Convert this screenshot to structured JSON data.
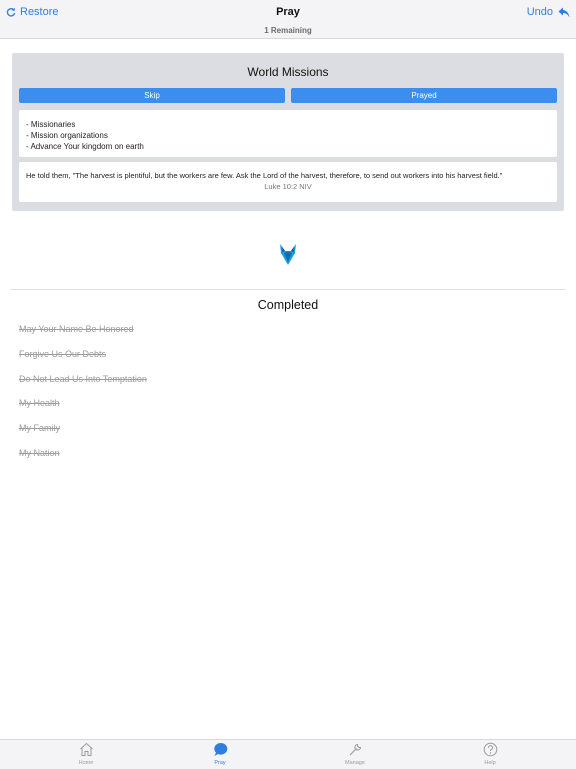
{
  "nav": {
    "restore_label": "Restore",
    "title": "Pray",
    "subtitle": "1 Remaining",
    "undo_label": "Undo"
  },
  "card": {
    "title": "World Missions",
    "skip_label": "Skip",
    "prayed_label": "Prayed",
    "points": [
      "- Missionaries",
      "- Mission organizations",
      "- Advance Your kingdom on earth"
    ],
    "verse_text": "He told them, \"The harvest is plentiful, but the workers are few. Ask the Lord of the harvest, therefore, to send out workers into his harvest field.\"",
    "verse_ref": "Luke 10:2 NIV"
  },
  "completed": {
    "title": "Completed",
    "items": [
      "May Your Name Be Honored",
      "Forgive Us Our Debts",
      "Do Not Lead Us Into Temptation",
      "My Health",
      "My Family",
      "My Nation"
    ]
  },
  "tabs": [
    {
      "label": "Home",
      "icon": "home-icon"
    },
    {
      "label": "Pray",
      "icon": "chat-bubble-icon"
    },
    {
      "label": "Manage",
      "icon": "wrench-icon"
    },
    {
      "label": "Help",
      "icon": "question-icon"
    }
  ],
  "colors": {
    "accent": "#2e7de1",
    "button": "#3b8ef0",
    "card_bg": "#dcdde2",
    "completed_text": "#9c9c9c",
    "logo_blue": "#1a9fe0"
  }
}
